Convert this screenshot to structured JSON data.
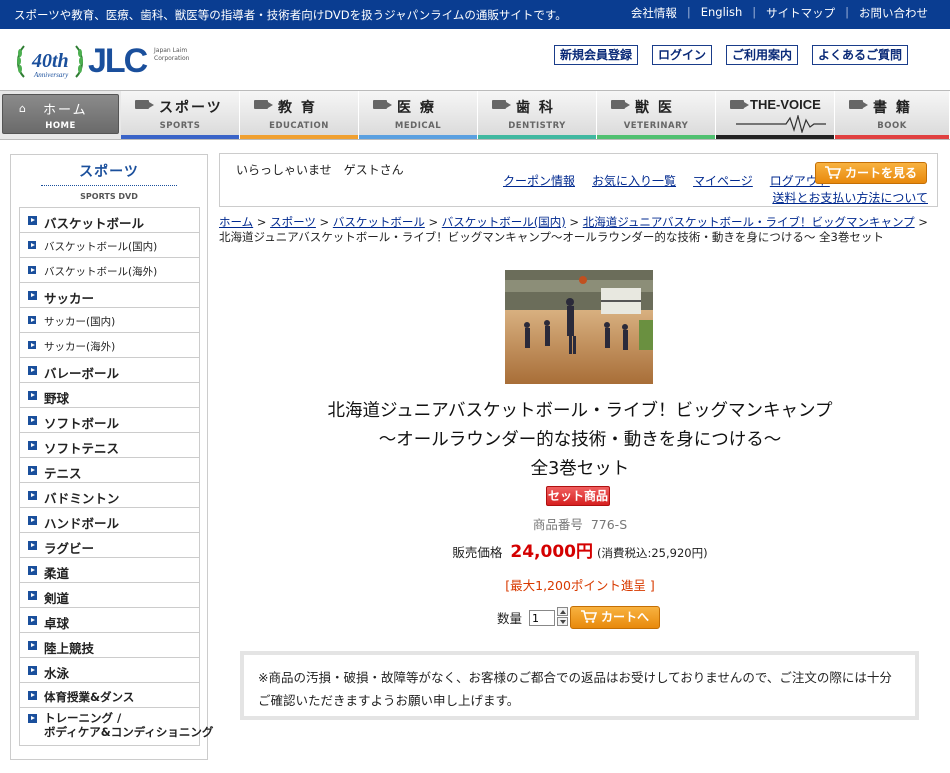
{
  "topbar": {
    "message": "スポーツや教育、医療、歯科、獣医等の指導者・技術者向けDVDを扱うジャパンライムの通販サイトです。",
    "links": [
      "会社情報",
      "English",
      "サイトマップ",
      "お問い合わせ"
    ]
  },
  "header": {
    "logo_text": "JLC",
    "logo_anniversary": "40th",
    "logo_anniversary_sub": "Anniversary",
    "logo_corp": "Japan Laim Corporation",
    "buttons": [
      "新規会員登録",
      "ログイン",
      "ご利用案内",
      "よくあるご質問"
    ]
  },
  "nav": [
    {
      "jp": "ホーム",
      "en": "HOME",
      "color": "#666666"
    },
    {
      "jp": "スポーツ",
      "en": "SPORTS",
      "color": "#3a64c8"
    },
    {
      "jp": "教 育",
      "en": "EDUCATION",
      "color": "#f0a030"
    },
    {
      "jp": "医 療",
      "en": "MEDICAL",
      "color": "#5aa0e0"
    },
    {
      "jp": "歯 科",
      "en": "DENTISTRY",
      "color": "#40b8a0"
    },
    {
      "jp": "獣 医",
      "en": "VETERINARY",
      "color": "#50c070"
    },
    {
      "jp": "THE-VOICE",
      "en": "",
      "color": "#222222"
    },
    {
      "jp": "書 籍",
      "en": "BOOK",
      "color": "#e04040"
    }
  ],
  "sidebar": {
    "title": "スポーツ",
    "subtitle": "SPORTS DVD",
    "items": [
      {
        "label": "バスケットボール",
        "type": "main"
      },
      {
        "label": "バスケットボール(国内)",
        "type": "sub"
      },
      {
        "label": "バスケットボール(海外)",
        "type": "sub"
      },
      {
        "label": "サッカー",
        "type": "main"
      },
      {
        "label": "サッカー(国内)",
        "type": "sub"
      },
      {
        "label": "サッカー(海外)",
        "type": "sub"
      },
      {
        "label": "バレーボール",
        "type": "main"
      },
      {
        "label": "野球",
        "type": "main"
      },
      {
        "label": "ソフトボール",
        "type": "main"
      },
      {
        "label": "ソフトテニス",
        "type": "main"
      },
      {
        "label": "テニス",
        "type": "main"
      },
      {
        "label": "バドミントン",
        "type": "main"
      },
      {
        "label": "ハンドボール",
        "type": "main"
      },
      {
        "label": "ラグビー",
        "type": "main"
      },
      {
        "label": "柔道",
        "type": "main"
      },
      {
        "label": "剣道",
        "type": "main"
      },
      {
        "label": "卓球",
        "type": "main"
      },
      {
        "label": "陸上競技",
        "type": "main"
      },
      {
        "label": "水泳",
        "type": "main"
      },
      {
        "label": "体育授業&ダンス",
        "type": "sm"
      },
      {
        "label": "トレーニング / ボディケア&コンディショニング",
        "type": "tall"
      }
    ]
  },
  "welcome": {
    "greeting": "いらっしゃいませ　ゲストさん",
    "links": [
      "クーポン情報",
      "お気に入り一覧",
      "マイページ",
      "ログアウト"
    ],
    "cart_button": "カートを見る",
    "shipping_link": "送料とお支払い方法について"
  },
  "breadcrumb": {
    "links": [
      "ホーム",
      "スポーツ",
      "バスケットボール",
      "バスケットボール(国内)",
      "北海道ジュニアバスケットボール・ライブ！ビッグマンキャンプ"
    ],
    "current": "北海道ジュニアバスケットボール・ライブ！ビッグマンキャンプ～オールラウンダー的な技術・動きを身につける～ 全3巻セット"
  },
  "product": {
    "title_lines": [
      "北海道ジュニアバスケットボール・ライブ！ビッグマンキャンプ",
      "～オールラウンダー的な技術・動きを身につける～",
      "全3巻セット"
    ],
    "badge": "セット商品",
    "code_label": "商品番号",
    "code": "776-S",
    "price_label": "販売価格",
    "price": "24,000円",
    "price_tax": "(消費税込:25,920円)",
    "points": "[最大1,200ポイント進呈 ]",
    "qty_label": "数量",
    "qty_value": "1",
    "add_button": "カートへ"
  },
  "notice": "※商品の汚損・破損・故障等がなく、お客様のご都合での返品はお受けしておりませんので、ご注文の際には十分ご確認いただきますようお願い申し上げます。",
  "colors": {
    "brand_blue": "#0a3d91",
    "accent_orange": "#e8890c",
    "price_red": "#d40000"
  }
}
